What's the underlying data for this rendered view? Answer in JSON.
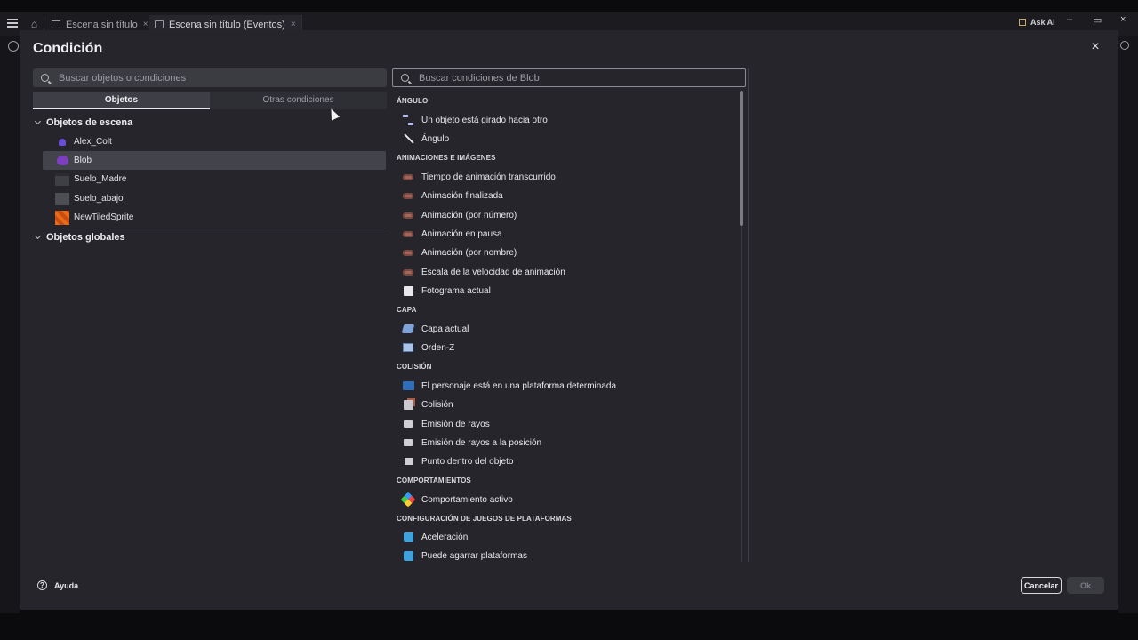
{
  "app_tabs": [
    {
      "label": "Escena sin título",
      "close": "×"
    },
    {
      "label": "Escena sin título (Eventos)",
      "close": "×"
    }
  ],
  "ask_ai": "Ask AI",
  "window_controls": {
    "minimize": "–",
    "restore": "▭",
    "close": "×"
  },
  "dialog": {
    "title": "Condición",
    "close": "×"
  },
  "objects_panel": {
    "search_placeholder": "Buscar objetos o condiciones",
    "tabs": [
      "Objetos",
      "Otras condiciones"
    ],
    "scene_header": "Objetos de escena",
    "scene_objects": [
      {
        "name": "Alex_Colt",
        "icon": "sprite-icon"
      },
      {
        "name": "Blob",
        "icon": "blob-sprite-icon",
        "selected": true
      },
      {
        "name": "Suelo_Madre",
        "icon": "ground-tile-icon"
      },
      {
        "name": "Suelo_abajo",
        "icon": "ground-tile-icon"
      },
      {
        "name": "NewTiledSprite",
        "icon": "tiled-sprite-icon"
      }
    ],
    "global_header": "Objetos globales"
  },
  "conditions_panel": {
    "search_placeholder": "Buscar condiciones de Blob",
    "sections": [
      {
        "title": "ÁNGULO",
        "items": [
          {
            "label": "Un objeto está girado hacia otro",
            "icon": "rotate-towards-icon"
          },
          {
            "label": "Ángulo",
            "icon": "angle-icon"
          }
        ]
      },
      {
        "title": "ANIMACIONES E IMÁGENES",
        "items": [
          {
            "label": "Tiempo de animación transcurrido",
            "icon": "animation-icon"
          },
          {
            "label": "Animación finalizada",
            "icon": "animation-icon"
          },
          {
            "label": "Animación (por número)",
            "icon": "animation-icon"
          },
          {
            "label": "Animación en pausa",
            "icon": "animation-icon"
          },
          {
            "label": "Animación (por nombre)",
            "icon": "animation-icon"
          },
          {
            "label": "Escala de la velocidad de animación",
            "icon": "animation-icon"
          },
          {
            "label": "Fotograma actual",
            "icon": "frame-icon"
          }
        ]
      },
      {
        "title": "CAPA",
        "items": [
          {
            "label": "Capa actual",
            "icon": "layer-icon"
          },
          {
            "label": "Orden-Z",
            "icon": "z-order-icon"
          }
        ]
      },
      {
        "title": "COLISIÓN",
        "items": [
          {
            "label": "El personaje está en una plataforma determinada",
            "icon": "platform-icon"
          },
          {
            "label": "Colisión",
            "icon": "collision-icon"
          },
          {
            "label": "Emisión de rayos",
            "icon": "raycast-icon"
          },
          {
            "label": "Emisión de rayos a la posición",
            "icon": "raycast-icon"
          },
          {
            "label": "Punto dentro del objeto",
            "icon": "point-inside-icon"
          }
        ]
      },
      {
        "title": "COMPORTAMIENTOS",
        "items": [
          {
            "label": "Comportamiento activo",
            "icon": "behavior-icon"
          }
        ]
      },
      {
        "title": "CONFIGURACIÓN DE JUEGOS DE PLATAFORMAS",
        "items": [
          {
            "label": "Aceleración",
            "icon": "puzzle-icon"
          },
          {
            "label": "Puede agarrar plataformas",
            "icon": "puzzle-icon"
          }
        ]
      }
    ]
  },
  "footer": {
    "help_label": "Ayuda",
    "cancel_label": "Cancelar",
    "ok_label": "Ok"
  }
}
